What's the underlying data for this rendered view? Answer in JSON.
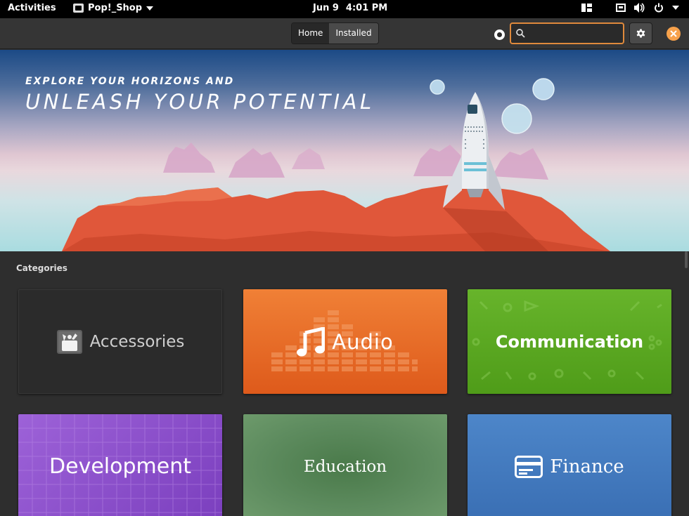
{
  "topbar": {
    "activities": "Activities",
    "app_name": "Pop!_Shop",
    "date": "Jun 9",
    "time": "4:01 PM"
  },
  "header": {
    "tabs": [
      {
        "label": "Home",
        "active": true
      },
      {
        "label": "Installed",
        "active": false
      }
    ],
    "search": {
      "value": "",
      "placeholder": ""
    }
  },
  "banner": {
    "line1": "EXPLORE YOUR HORIZONS AND",
    "line2": "UNLEASH YOUR POTENTIAL"
  },
  "categories": {
    "heading": "Categories",
    "items": [
      {
        "label": "Accessories",
        "icon": "accessories-icon",
        "color": "#2b2b2b"
      },
      {
        "label": "Audio",
        "icon": "music-note-icon",
        "color": "#e8692a"
      },
      {
        "label": "Communication",
        "icon": "",
        "color": "#5aa822"
      },
      {
        "label": "Development",
        "icon": "",
        "color": "#8c50cc"
      },
      {
        "label": "Education",
        "icon": "",
        "color": "#5e8c5f"
      },
      {
        "label": "Finance",
        "icon": "card-icon",
        "color": "#437bbf"
      }
    ]
  },
  "colors": {
    "accent": "#e08a3c",
    "close": "#f7a14b",
    "headerbar": "#353535",
    "background": "#2e2e2e"
  }
}
